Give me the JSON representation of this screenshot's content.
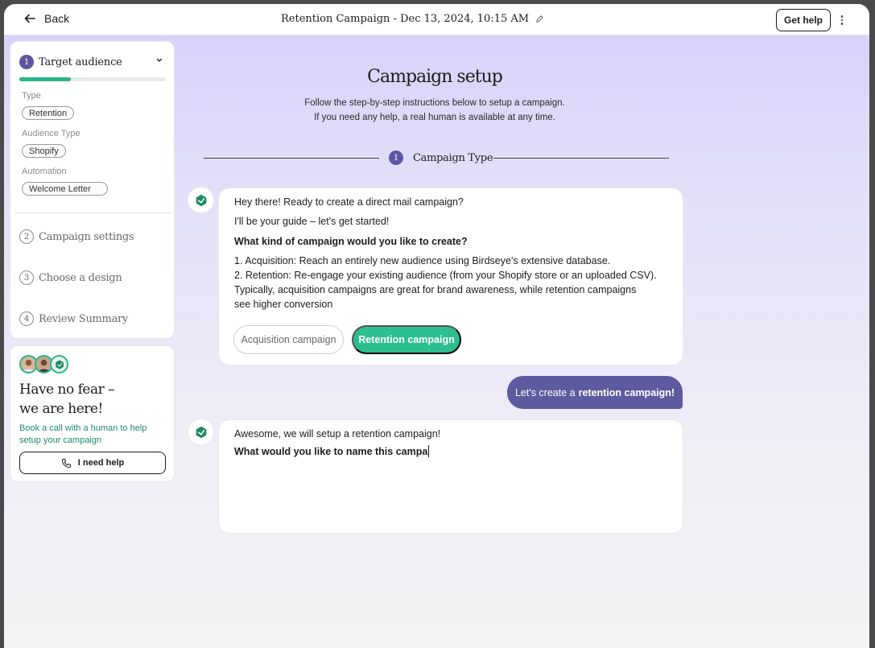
{
  "topbar": {
    "back_label": "Back",
    "title": "Retention Campaign - Dec 13, 2024, 10:15 AM",
    "help_label": "Get help"
  },
  "sidebar": {
    "current_step": {
      "number": "1",
      "label": "Target audience",
      "progress_percent": 35
    },
    "fields": [
      {
        "label": "Type",
        "value": "Retention"
      },
      {
        "label": "Audience Type",
        "value": "Shopify"
      },
      {
        "label": "Automation",
        "value": "Welcome Letter"
      }
    ],
    "steps": [
      {
        "number": "2",
        "label": "Campaign settings"
      },
      {
        "number": "3",
        "label": "Choose a design"
      },
      {
        "number": "4",
        "label": "Review Summary"
      }
    ]
  },
  "help_card": {
    "title_line1": "Have no fear –",
    "title_line2": "we are here!",
    "subtitle": "Book a call with a human to help setup your campaign",
    "button_label": "I need help"
  },
  "main": {
    "title": "Campaign setup",
    "subtitle_line1": "Follow the step-by-step instructions below to setup a campaign.",
    "subtitle_line2": "If you need any help, a real human is available at any time.",
    "section_number": "1",
    "section_label": "Campaign Type"
  },
  "chat": {
    "bot_message_1": {
      "greeting": "Hey there! Ready to create a direct mail campaign?",
      "intro": "I'll be your guide – let's get started!",
      "question": "What kind of campaign would you like to create?",
      "option_1": "1. Acquisition: Reach an entirely new audience using Birdseye's extensive database.",
      "option_2_line1": "2. Retention: Re-engage your existing audience (from your Shopify store or an uploaded CSV).",
      "option_2_line2": "Typically, acquisition campaigns are great for brand awareness, while retention campaigns",
      "option_2_line3": "see higher conversion",
      "acquisition_button": "Acquisition campaign",
      "retention_button": "Retention campaign"
    },
    "user_message": {
      "prefix": "Let's create a",
      "bold": "retention campaign!"
    },
    "bot_message_2": {
      "confirm": "Awesome, we will setup a retention campaign!",
      "question_typing": "What would you like to name this campa"
    }
  },
  "colors": {
    "accent_green": "#2bbf8f",
    "accent_purple": "#5d5aa0",
    "background_top": "#d6d1fa"
  },
  "icons": [
    "arrow-left-icon",
    "pencil-icon",
    "more-vertical-icon",
    "chevron-down-icon",
    "phone-icon",
    "birdseye-logo-icon"
  ]
}
